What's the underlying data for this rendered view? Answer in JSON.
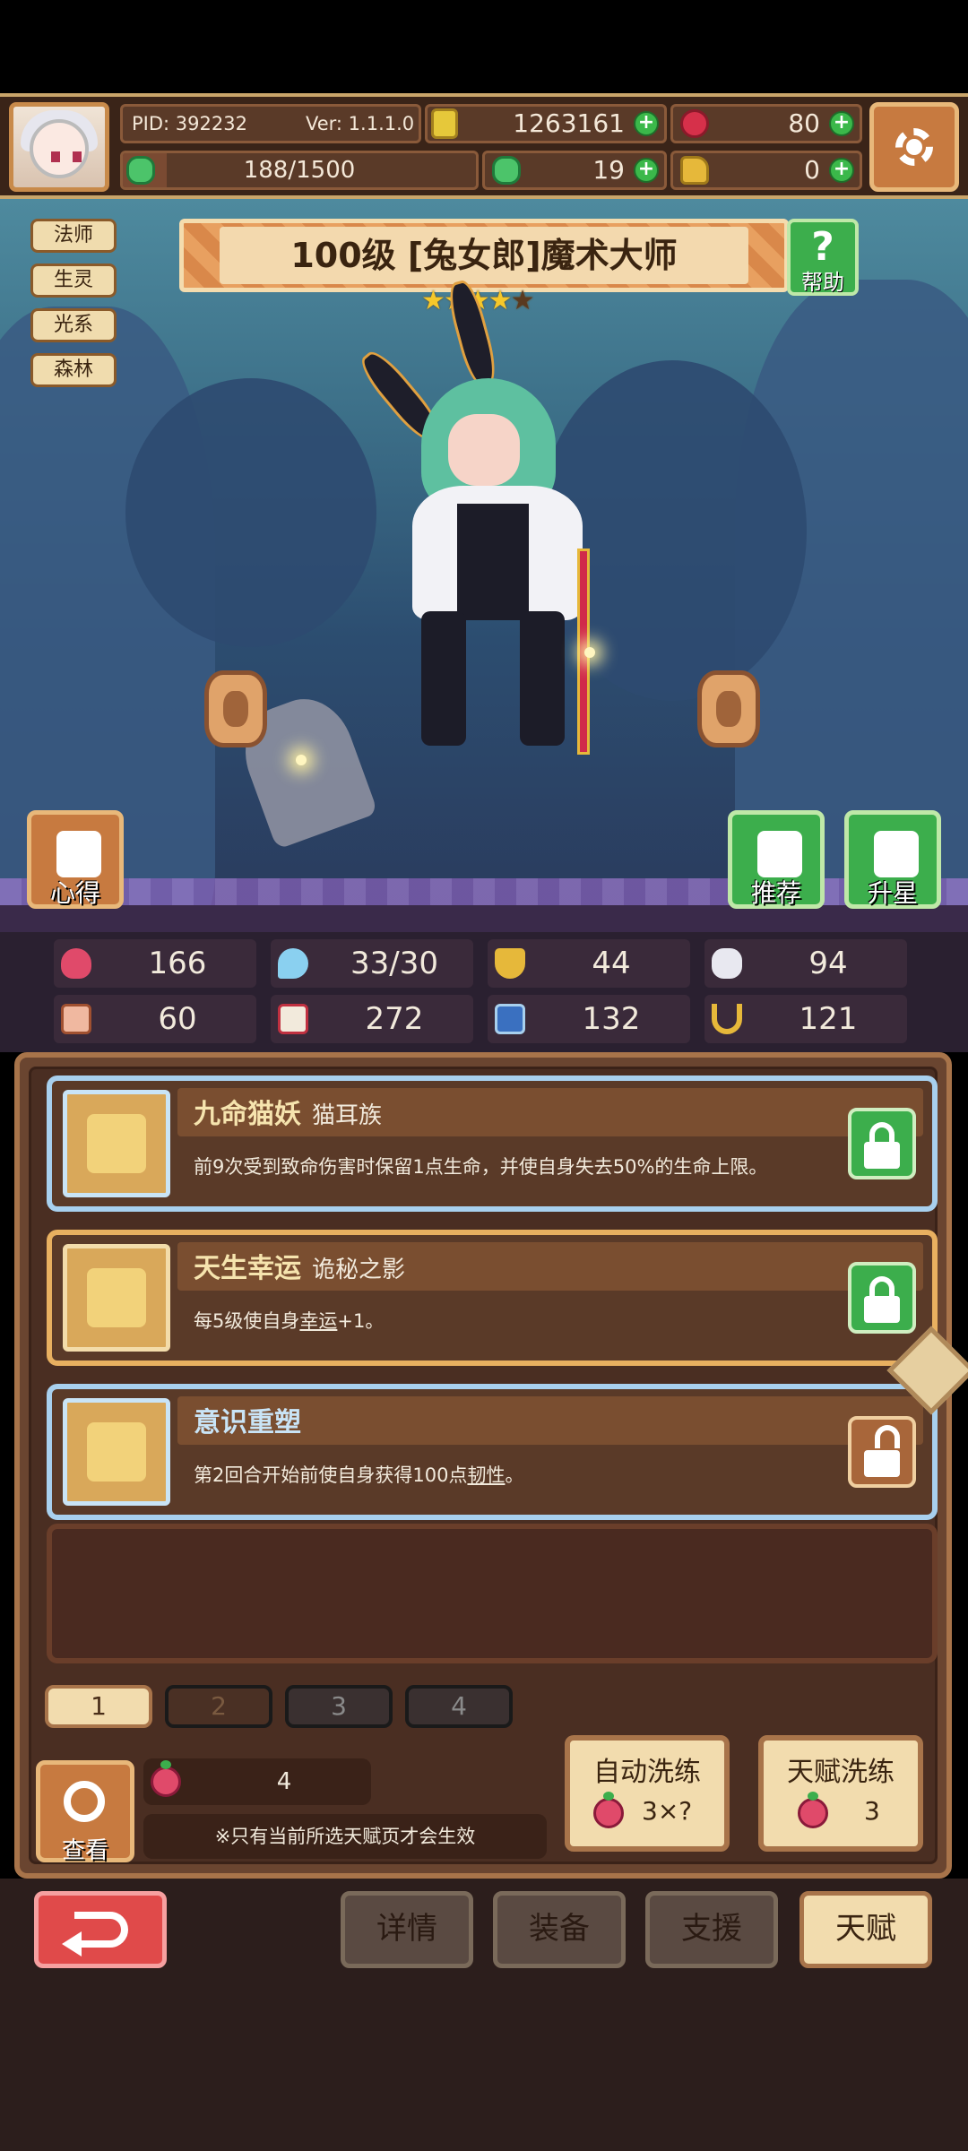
{
  "hud": {
    "pid": "PID: 392232",
    "version": "Ver: 1.1.1.0",
    "gold": "1263161",
    "ruby": "80",
    "energy": "188/1500",
    "energy_fraction": 0.125,
    "clover": "19",
    "bag": "0"
  },
  "scene": {
    "tags": [
      "法师",
      "生灵",
      "光系",
      "森林"
    ],
    "title": "100级 [兔女郎]魔术大师",
    "stars_filled": "★★★★",
    "stars_empty": "★",
    "help_label": "帮助",
    "insight_label": "心得",
    "recommend_label": "推荐",
    "upstar_label": "升星"
  },
  "stats": {
    "hp": "166",
    "mana": "33/30",
    "defense": "44",
    "speed": "94",
    "attack": "60",
    "magic": "272",
    "res": "132",
    "luck": "121"
  },
  "talents": [
    {
      "name": "九命猫妖",
      "sub": "猫耳族",
      "desc": "前9次受到致命伤害时保留1点生命，并使自身失去50%的生命上限。"
    },
    {
      "name": "天生幸运",
      "sub": "诡秘之影",
      "desc_pre": "每5级使自身",
      "desc_link": "幸运",
      "desc_post": "+1。"
    },
    {
      "name": "意识重塑",
      "sub": "",
      "desc_pre": "第2回合开始前使自身获得100点",
      "desc_link": "韧性",
      "desc_post": "。"
    }
  ],
  "pages": [
    "1",
    "2",
    "3",
    "4"
  ],
  "footer": {
    "view_label": "查看",
    "fruit_count": "4",
    "note": "※只有当前所选天赋页才会生效",
    "auto_reroll": "自动洗练",
    "auto_cost": "3×?",
    "talent_reroll": "天赋洗练",
    "talent_cost": "3"
  },
  "nav": [
    "详情",
    "装备",
    "支援",
    "天赋"
  ]
}
